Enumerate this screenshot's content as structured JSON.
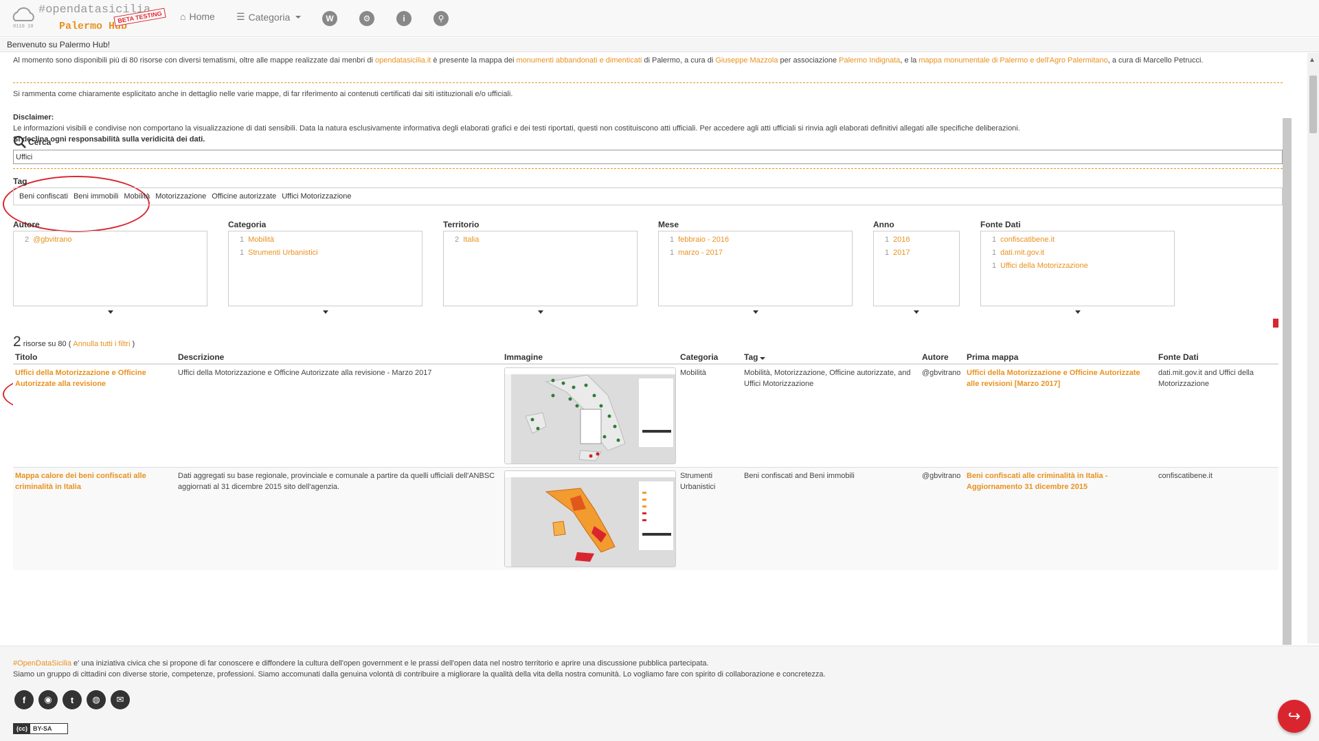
{
  "navbar": {
    "brand_top": "#opendatasicilia",
    "brand_bottom": "Palermo Hub",
    "beta_badge": "BETA TESTING",
    "home_label": "Home",
    "category_label": "Categoria",
    "icons": [
      "wikipedia-icon",
      "settings-icon",
      "info-icon",
      "search-icon"
    ]
  },
  "welcome": "Benvenuto su Palermo Hub!",
  "intro": {
    "t1": "Al momento sono disponibili più di 80 risorse con diversi tematismi, oltre alle mappe realizzate dai menbri di ",
    "l1": "opendatasicilia.it",
    "t2": " è presente la mappa dei ",
    "l2": "monumenti abbandonati e dimenticati",
    "t3": " di Palermo, a cura di ",
    "l3": "Giuseppe Mazzola",
    "t4": " per associazione ",
    "l4": "Palermo Indignata",
    "t5": ", e la ",
    "l5": "mappa monumentale di Palermo e dell'Agro Palermitano",
    "t6": ", a cura di Marcello Petrucci."
  },
  "reminder": "Si rammenta come chiaramente esplicitato anche in dettaglio nelle varie mappe, di far riferimento ai contenuti certificati dai siti istituzionali e/o ufficiali.",
  "disclaimer": {
    "title": "Disclaimer:",
    "body": "Le informazioni visibili e condivise non comportano la visualizzazione di dati sensibili. Data la natura esclusivamente informativa degli elaborati grafici e dei testi riportati, questi non costituiscono atti ufficiali. Per accedere agli atti ufficiali si rinvia agli elaborati definitivi allegati alle specifiche deliberazioni.",
    "bold": "Si declina ogni responsabilità sulla veridicità dei dati."
  },
  "search": {
    "label": "Cerca",
    "value": "Uffici"
  },
  "tags": {
    "label": "Tag",
    "items": [
      "Beni confiscati",
      "Beni immobili",
      "Mobilità",
      "Motorizzazione",
      "Officine autorizzate",
      "Uffici Motorizzazione"
    ]
  },
  "facets": {
    "autore": {
      "title": "Autore",
      "items": [
        {
          "count": "2",
          "label": "@gbvitrano"
        }
      ]
    },
    "categoria": {
      "title": "Categoria",
      "items": [
        {
          "count": "1",
          "label": "Mobilità"
        },
        {
          "count": "1",
          "label": "Strumenti Urbanistici"
        }
      ]
    },
    "territorio": {
      "title": "Territorio",
      "items": [
        {
          "count": "2",
          "label": "Italia"
        }
      ]
    },
    "mese": {
      "title": "Mese",
      "items": [
        {
          "count": "1",
          "label": "febbraio - 2016"
        },
        {
          "count": "1",
          "label": "marzo - 2017"
        }
      ]
    },
    "anno": {
      "title": "Anno",
      "items": [
        {
          "count": "1",
          "label": "2016"
        },
        {
          "count": "1",
          "label": "2017"
        }
      ]
    },
    "fonte": {
      "title": "Fonte Dati",
      "items": [
        {
          "count": "1",
          "label": "confiscatibene.it"
        },
        {
          "count": "1",
          "label": "dati.mit.gov.it"
        },
        {
          "count": "1",
          "label": "Uffici della Motorizzazione"
        }
      ]
    }
  },
  "results": {
    "count": "2",
    "text": "risorse su 80 (",
    "clear": "Annulla tutti i filtri",
    "close": ")"
  },
  "table": {
    "headers": [
      "Titolo",
      "Descrizione",
      "Immagine",
      "Categoria",
      "Tag",
      "Autore",
      "Prima mappa",
      "Fonte Dati"
    ],
    "rows": [
      {
        "titolo": "Uffici della Motorizzazione e Officine Autorizzate alla revisione",
        "descrizione": "Uffici della Motorizzazione e Officine Autorizzate alla revisione - Marzo 2017",
        "categoria": "Mobilità",
        "tag": "Mobilità, Motorizzazione, Officine autorizzate, and Uffici Motorizzazione",
        "autore": "@gbvitrano",
        "prima_mappa": "Uffici della Motorizzazione e Officine Autorizzate alle revisioni [Marzo 2017]",
        "fonte": "dati.mit.gov.it and Uffici della Motorizzazione"
      },
      {
        "titolo": "Mappa calore dei beni confiscati alle criminalità in Italia",
        "descrizione": "Dati aggregati su base regionale, provinciale e comunale a partire da quelli ufficiali dell'ANBSC aggiornati al 31 dicembre 2015 sito dell'agenzia.",
        "categoria": "Strumenti Urbanistici",
        "tag": "Beni confiscati and Beni immobili",
        "autore": "@gbvitrano",
        "prima_mappa": "Beni confiscati alle criminalità in Italia - Aggiornamento 31 dicembre 2015",
        "fonte": "confiscatibene.it"
      }
    ]
  },
  "footer": {
    "brand": "#OpenDataSicilia",
    "line1": " e' una iniziativa civica che si propone di far conoscere e diffondere la cultura dell'open government e le prassi dell'open data nel nostro territorio e aprire una discussione pubblica partecipata.",
    "line2": "Siamo un gruppo di cittadini con diverse storie, competenze, professioni. Siamo accomunati dalla genuina volontà di contribuire a migliorare la qualità della vita della nostra comunità. Lo vogliamo fare con spirito di collaborazione e concretezza.",
    "social": [
      "facebook-icon",
      "github-icon",
      "twitter-icon",
      "globe-icon",
      "email-icon"
    ],
    "license": "BY-SA"
  },
  "colors": {
    "accent": "#e8911e",
    "red": "#d9262e"
  }
}
